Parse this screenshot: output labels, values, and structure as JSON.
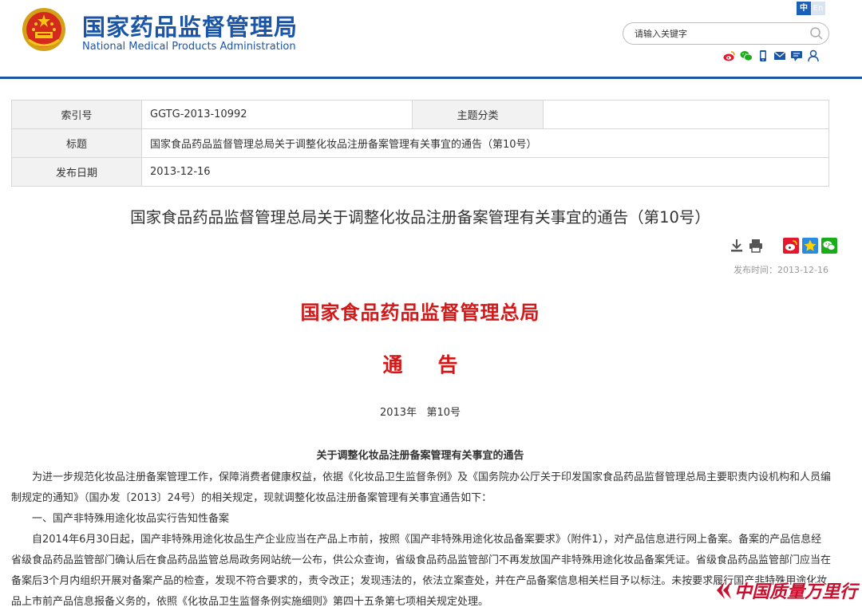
{
  "header": {
    "site_name_cn": "国家药品监督管理局",
    "site_name_en": "National Medical Products Administration",
    "lang_zh": "中",
    "lang_en": "En",
    "search_placeholder": "请输入关键字"
  },
  "meta": {
    "index_label": "索引号",
    "index_value": "GGTG-2013-10992",
    "category_label": "主题分类",
    "category_value": "",
    "title_label": "标题",
    "title_value": "国家食品药品监督管理总局关于调整化妆品注册备案管理有关事宜的通告（第10号）",
    "date_label": "发布日期",
    "date_value": "2013-12-16"
  },
  "article": {
    "title": "国家食品药品监督管理总局关于调整化妆品注册备案管理有关事宜的通告（第10号）",
    "publish_time": "发布时间：2013-12-16",
    "agency": "国家食品药品监督管理总局",
    "notice_word": "通告",
    "doc_number": "2013年   第10号",
    "subtitle": "关于调整化妆品注册备案管理有关事宜的通告",
    "paragraphs": [
      "为进一步规范化妆品注册备案管理工作，保障消费者健康权益，依据《化妆品卫生监督条例》及《国务院办公厅关于印发国家食品药品监督管理总局主要职责内设机构和人员编制规定的通知》（国办发〔2013〕24号）的相关规定，现就调整化妆品注册备案管理有关事宜通告如下：",
      "一、国产非特殊用途化妆品实行告知性备案",
      "自2014年6月30日起，国产非特殊用途化妆品生产企业应当在产品上市前，按照《国产非特殊用途化妆品备案要求》（附件1），对产品信息进行网上备案。备案的产品信息经省级食品药品监管部门确认后在食品药品监管总局政务网站统一公布，供公众查询，省级食品药品监管部门不再发放国产非特殊用途化妆品备案凭证。省级食品药品监管部门应当在备案后3个月内组织开展对备案产品的检查，发现不符合要求的，责令改正；发现违法的，依法立案查处，并在产品备案信息相关栏目予以标注。未按要求履行国产非特殊用途化妆品上市前产品信息报备义务的，依照《化妆品卫生监督条例实施细则》第四十五条第七项相关规定处理。"
    ]
  },
  "watermark": {
    "text": "中国质量万里行"
  },
  "colors": {
    "brand_blue": "#1a55a8",
    "headline_red": "#d21818",
    "watermark_red": "#c8102e"
  },
  "icons": [
    "national-emblem-icon",
    "search-icon",
    "weibo-icon",
    "wechat-icon",
    "mobile-icon",
    "email-icon",
    "message-icon",
    "user-icon",
    "download-icon",
    "print-icon",
    "weibo-share-icon",
    "qzone-share-icon",
    "wechat-share-icon",
    "watermark-logo-icon"
  ]
}
